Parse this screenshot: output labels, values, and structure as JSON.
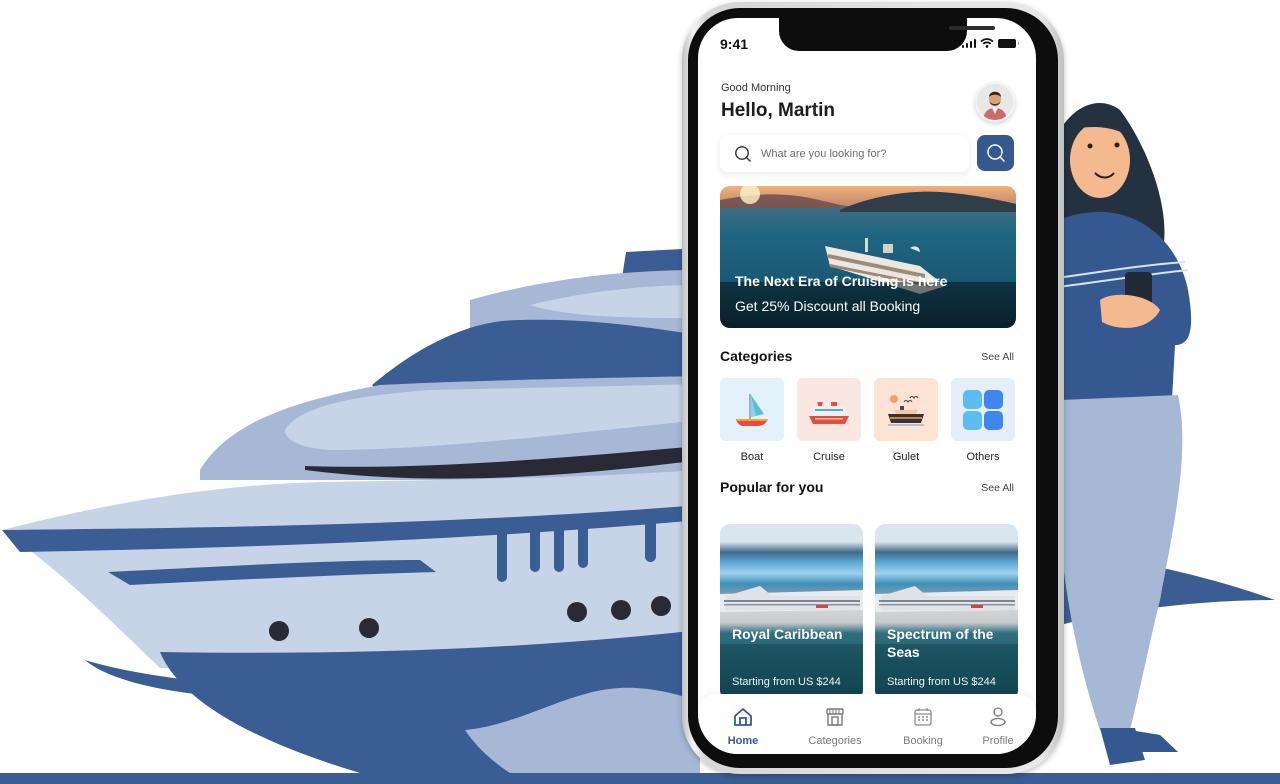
{
  "colors": {
    "brand_blue": "#355890",
    "ship_dark": "#3a5d94",
    "ship_mid": "#a6b8d6",
    "ship_light": "#c7d4e8",
    "window_dark": "#2a2a36"
  },
  "status_bar": {
    "time": "9:41",
    "icons": [
      "signal-icon",
      "wifi-icon",
      "battery-icon"
    ]
  },
  "header": {
    "greeting": "Good Morning",
    "title": "Hello, Martin",
    "avatar_icon": "user-avatar"
  },
  "search": {
    "placeholder": "What are you looking for?",
    "value": "",
    "icon": "search-icon",
    "button_icon": "search-icon"
  },
  "banner": {
    "title": "The Next Era of Cruising is here",
    "subtitle": "Get 25% Discount all Booking"
  },
  "categories": {
    "title": "Categories",
    "see_all": "See All",
    "items": [
      {
        "label": "Boat",
        "icon": "sailboat-icon",
        "bg": "#e3f1fb"
      },
      {
        "label": "Cruise",
        "icon": "cruise-ship-icon",
        "bg": "#fbe7e2"
      },
      {
        "label": "Gulet",
        "icon": "gulet-icon",
        "bg": "#fde3d3"
      },
      {
        "label": "Others",
        "icon": "grid-icon",
        "bg": "#e6edfb"
      }
    ]
  },
  "popular": {
    "title": "Popular for you",
    "see_all": "See All",
    "items": [
      {
        "name": "Royal Caribbean",
        "price": "Starting from US $244"
      },
      {
        "name": "Spectrum of the Seas",
        "price": "Starting from US $244"
      }
    ]
  },
  "tabbar": {
    "items": [
      {
        "label": "Home",
        "icon": "home-icon",
        "active": true
      },
      {
        "label": "Categories",
        "icon": "store-icon",
        "active": false
      },
      {
        "label": "Booking",
        "icon": "calendar-icon",
        "active": false
      },
      {
        "label": "Profile",
        "icon": "user-icon",
        "active": false
      }
    ]
  }
}
